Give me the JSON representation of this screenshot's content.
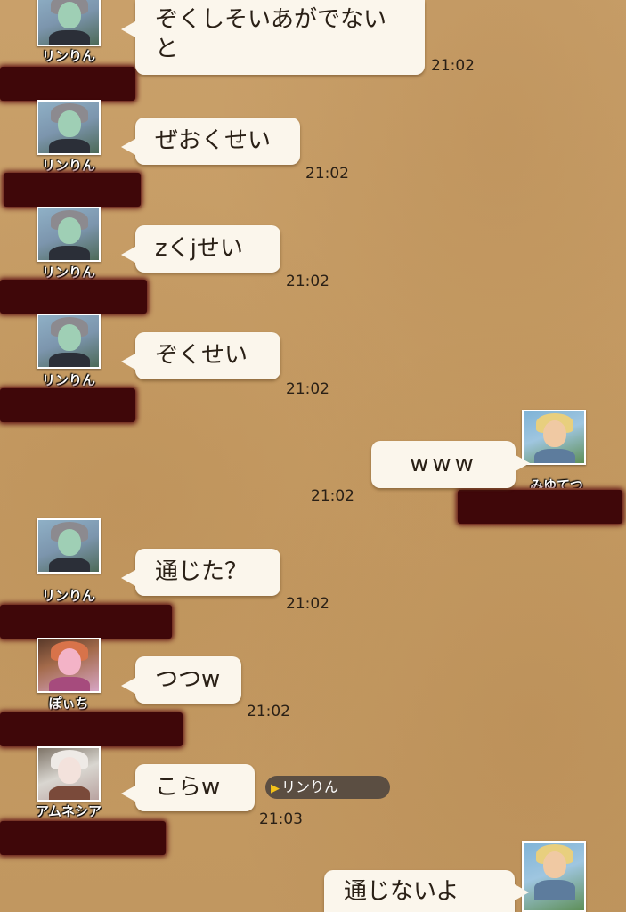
{
  "messages": [
    {
      "sender": "リンりん",
      "text": "ぞくしそいあがでないと",
      "time": "21:02"
    },
    {
      "sender": "リンりん",
      "text": "ぜおくせい",
      "time": "21:02"
    },
    {
      "sender": "リンりん",
      "text": "zくjせい",
      "time": "21:02"
    },
    {
      "sender": "リンりん",
      "text": "ぞくせい",
      "time": "21:02"
    },
    {
      "sender": "みゆてつ",
      "text": "www",
      "time": "21:02"
    },
    {
      "sender": "リンりん",
      "text": "通じた？",
      "time": "21:02"
    },
    {
      "sender": "ぽぃち",
      "text": "つつw",
      "time": "21:02"
    },
    {
      "sender": "アムネシア",
      "text": "こらw",
      "time": "21:03",
      "mention": "リンりん"
    },
    {
      "sender": "",
      "text": "通じないよ",
      "time": ""
    }
  ],
  "colors": {
    "background": "#c59b63",
    "bubble": "#fbf6ec",
    "redaction": "#3f0709",
    "mention_pill": "#5b4e42",
    "mention_arrow": "#f3c21a"
  },
  "icons": {
    "mention": "play-triangle-icon"
  }
}
